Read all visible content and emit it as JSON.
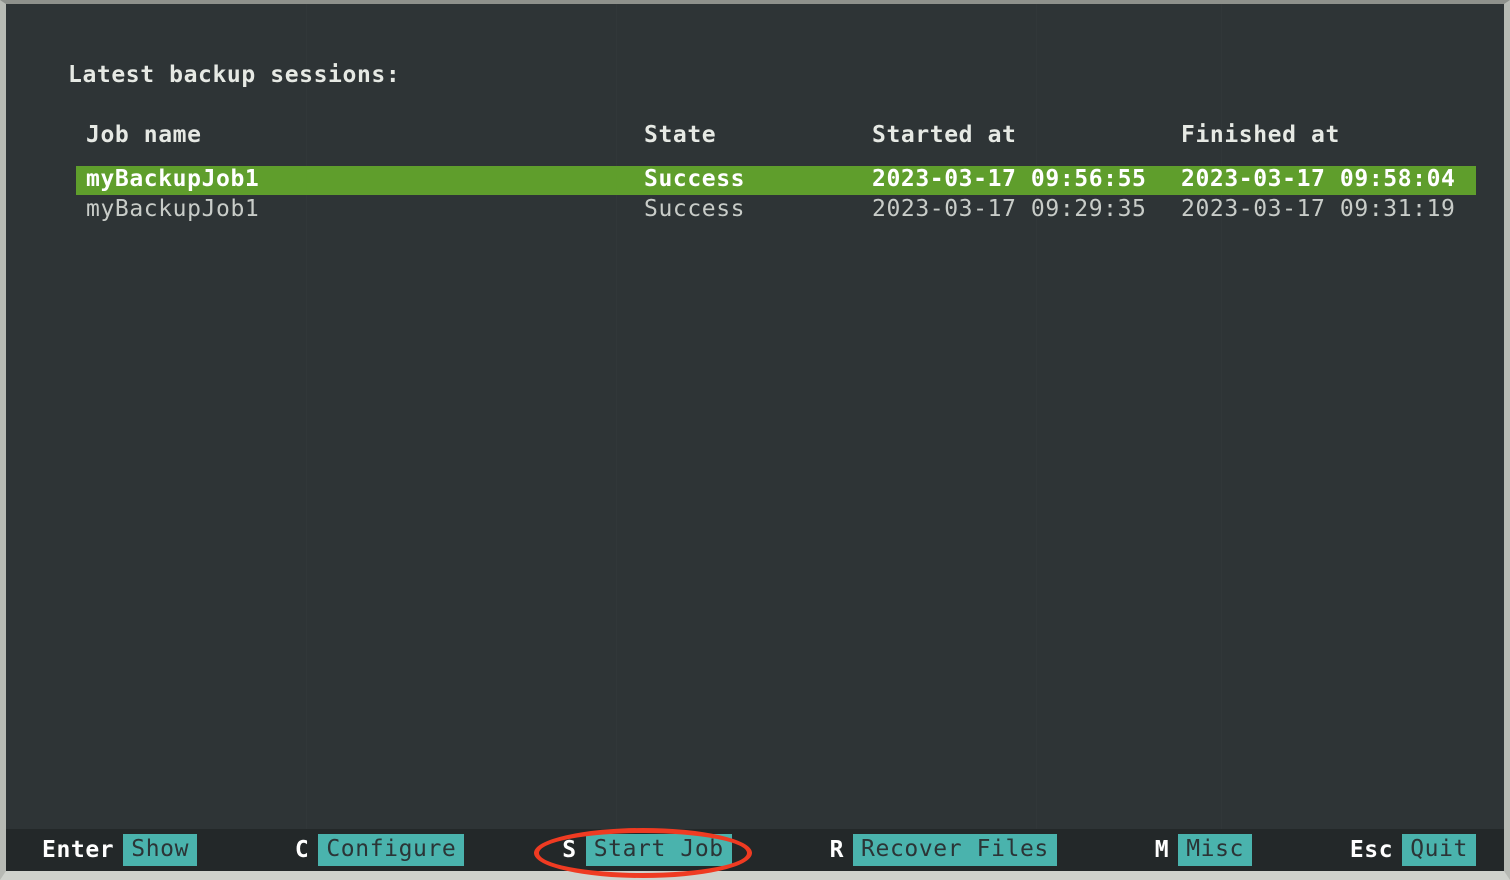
{
  "screen": {
    "heading": "Latest backup sessions:",
    "background_color": "#2e3436",
    "selection_color": "#5f9e2c",
    "accent_color": "#4ab3ad",
    "annotation_color": "#ef3b22"
  },
  "table": {
    "columns": {
      "job_name": "Job name",
      "state": "State",
      "started_at": "Started at",
      "finished_at": "Finished at"
    },
    "rows": [
      {
        "job_name": "myBackupJob1",
        "state": "Success",
        "started_at": "2023-03-17 09:56:55",
        "finished_at": "2023-03-17 09:58:04",
        "selected": true
      },
      {
        "job_name": "myBackupJob1",
        "state": "Success",
        "started_at": "2023-03-17 09:29:35",
        "finished_at": "2023-03-17 09:31:19",
        "selected": false
      }
    ]
  },
  "status_bar": {
    "keybindings": [
      {
        "key": "Enter",
        "action": "Show"
      },
      {
        "key": "C",
        "action": "Configure"
      },
      {
        "key": "S",
        "action": "Start Job"
      },
      {
        "key": "R",
        "action": "Recover Files"
      },
      {
        "key": "M",
        "action": "Misc"
      },
      {
        "key": "Esc",
        "action": "Quit"
      }
    ]
  }
}
